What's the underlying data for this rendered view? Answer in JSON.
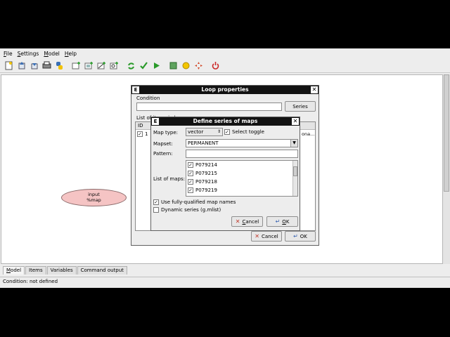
{
  "menu": [
    {
      "key": "F",
      "rest": "ile"
    },
    {
      "key": "S",
      "rest": "ettings"
    },
    {
      "key": "M",
      "rest": "odel"
    },
    {
      "key": "H",
      "rest": "elp"
    }
  ],
  "toolbar_icons": [
    "new-model-icon",
    "open-model-icon",
    "save-model-icon",
    "export-image-icon",
    "export-python-icon",
    "add-command-icon",
    "add-data-icon",
    "add-relation-icon",
    "add-loop-icon",
    "redraw-icon",
    "validate-icon",
    "run-icon",
    "variables-icon",
    "settings-icon",
    "layout-icon",
    "quit-icon"
  ],
  "canvas": {
    "node_line1": "input",
    "node_line2": "%map"
  },
  "bottom_tabs": {
    "model": "Model",
    "model_key": "M",
    "model_rest": "odel",
    "items": "Items",
    "variables": "Variables",
    "command_output": "Command output"
  },
  "status": "Condition: not defined",
  "loop_dialog": {
    "title": "Loop properties",
    "app_icon": "E",
    "condition_label": "Condition",
    "condition_value": "",
    "series_button": "Series",
    "list_label": "List of items in loop",
    "col_id": "ID",
    "row_id": "1",
    "row_tail": "ona...",
    "cancel": "Cancel",
    "ok": "OK"
  },
  "series_dialog": {
    "title": "Define series of maps",
    "app_icon": "E",
    "map_type_label": "Map type:",
    "map_type_value": "vector",
    "select_toggle": "Select toggle",
    "mapset_label": "Mapset:",
    "mapset_value": "PERMANENT",
    "pattern_label": "Pattern:",
    "pattern_value": "",
    "list_label": "List of maps:",
    "maps": [
      "P079214",
      "P079215",
      "P079218",
      "P079219"
    ],
    "fully_qualified": "Use fully-qualified map names",
    "dynamic_series": "Dynamic series (g.mlist)",
    "cancel_key": "C",
    "cancel_rest": "ancel",
    "ok_key": "O",
    "ok_rest": "K"
  }
}
